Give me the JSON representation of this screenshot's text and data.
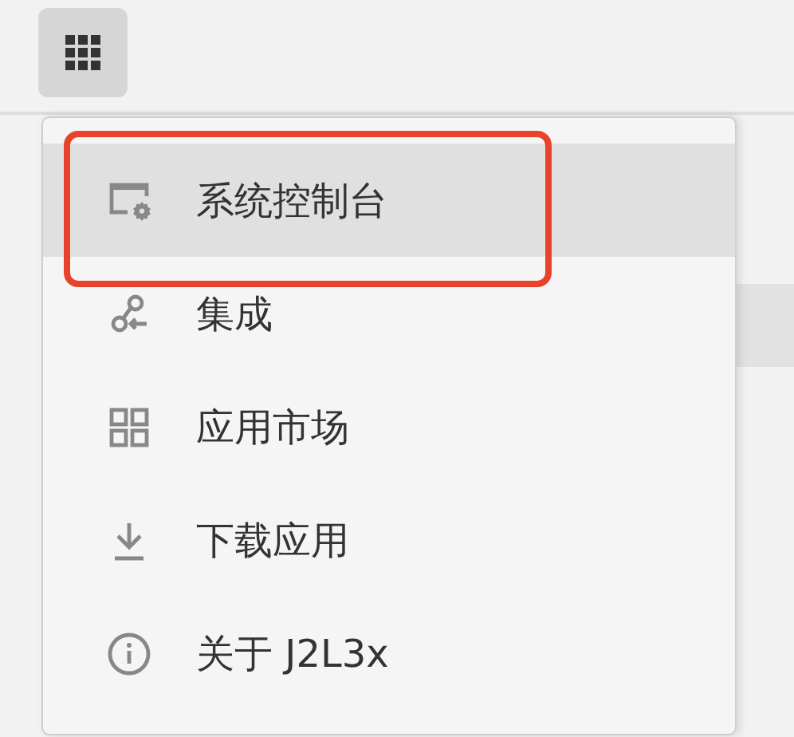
{
  "toolbar": {
    "apps_button": {
      "pressed": true
    }
  },
  "menu": {
    "items": [
      {
        "kind": "console",
        "label": "系统控制台",
        "selected": true,
        "outlined": true
      },
      {
        "kind": "integration",
        "label": "集成",
        "selected": false,
        "outlined": false
      },
      {
        "kind": "market",
        "label": "应用市场",
        "selected": false,
        "outlined": false
      },
      {
        "kind": "download",
        "label": "下载应用",
        "selected": false,
        "outlined": false
      },
      {
        "kind": "info",
        "label": "关于 J2L3x",
        "selected": false,
        "outlined": false
      }
    ]
  }
}
